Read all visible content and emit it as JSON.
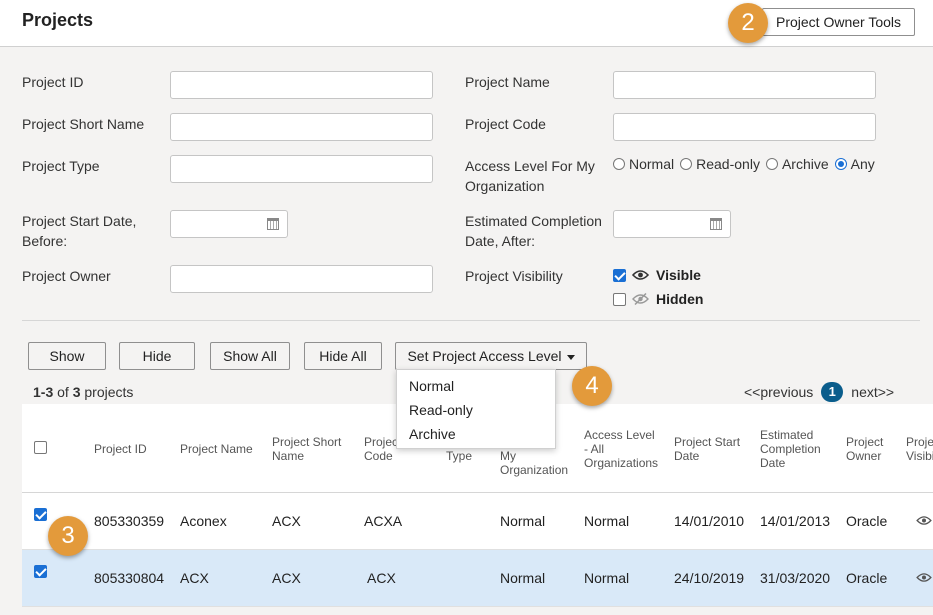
{
  "header": {
    "title": "Projects",
    "owner_tools_label": "Project Owner Tools"
  },
  "callouts": {
    "c2": "2",
    "c3": "3",
    "c4": "4"
  },
  "filters": {
    "project_id": "Project ID",
    "project_name": "Project Name",
    "project_short_name": "Project Short Name",
    "project_code": "Project Code",
    "project_type": "Project Type",
    "access_level_line1": "Access Level For My",
    "access_level_line2": "Organization",
    "start_date_line1": "Project Start Date,",
    "start_date_line2": "Before:",
    "est_completion_line1": "Estimated Completion",
    "est_completion_line2": "Date, After:",
    "project_owner": "Project Owner",
    "project_visibility": "Project Visibility",
    "access_options": [
      "Normal",
      "Read-only",
      "Archive",
      "Any"
    ],
    "access_selected": "Any",
    "visible_label": "Visible",
    "hidden_label": "Hidden",
    "visible_checked": true,
    "hidden_checked": false
  },
  "actions": {
    "show": "Show",
    "hide": "Hide",
    "show_all": "Show All",
    "hide_all": "Hide All",
    "set_access_level": "Set Project Access Level"
  },
  "dropdown": {
    "items": [
      "Normal",
      "Read-only",
      "Archive"
    ]
  },
  "summary": {
    "range": "1-3",
    "of": "of",
    "total": "3",
    "suffix": "projects"
  },
  "pager": {
    "previous": "<<previous",
    "current": "1",
    "next": "next>>"
  },
  "table": {
    "headers": {
      "project_id": "Project ID",
      "project_name": "Project Name",
      "short_name_1": "Project Short",
      "short_name_2": "Name",
      "code_1": "Projec",
      "code_2": "Code",
      "type": "Type",
      "my_org_1": "My",
      "my_org_2": "Organization",
      "all_org_1": "Access Level",
      "all_org_2": "- All",
      "all_org_3": "Organizations",
      "start_1": "Project Start",
      "start_2": "Date",
      "est_1": "Estimated",
      "est_2": "Completion",
      "est_3": "Date",
      "owner_1": "Project",
      "owner_2": "Owner",
      "vis_1": "Proje",
      "vis_2": "Visibi"
    },
    "rows": [
      {
        "checked": true,
        "id": "805330359",
        "name": "Aconex",
        "short": "ACX",
        "code": "ACXA",
        "type": "",
        "my_org": "Normal",
        "all_org": "Normal",
        "start": "14/01/2010",
        "est": "14/01/2013",
        "owner": "Oracle"
      },
      {
        "checked": true,
        "id": "805330804",
        "name": "ACX",
        "short": "ACX",
        "code": "ACX",
        "type": "",
        "my_org": "Normal",
        "all_org": "Normal",
        "start": "24/10/2019",
        "est": "31/03/2020",
        "owner": "Oracle"
      }
    ]
  },
  "colors": {
    "accent": "#1a6fd4",
    "callout": "#e39a3b",
    "pager": "#0a5d8c",
    "selected_row": "#d9e9f8"
  },
  "icons": {
    "date_picker": "calendar-icon",
    "visible": "eye-icon",
    "hidden": "eye-slash-icon"
  }
}
